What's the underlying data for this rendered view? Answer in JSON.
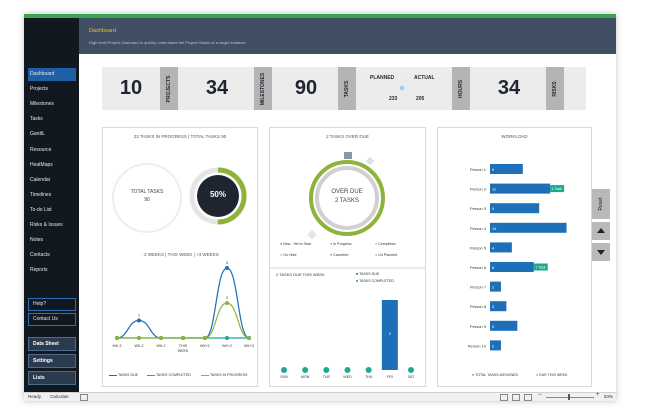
{
  "sidebar": {
    "items": [
      "Dashboard",
      "Projects",
      "Milestones",
      "Tasks",
      "GanttL",
      "Resource",
      "HeatMaps",
      "Calendar",
      "Timelines",
      "To-do List",
      "Risks & Issues",
      "Notes",
      "Contacts",
      "Reports"
    ],
    "links": [
      "Help?",
      "Contact Us"
    ],
    "buttons": [
      "Data Sheet",
      "Settings",
      "Lists"
    ]
  },
  "header": {
    "title": "Dashboard",
    "subtitle": "High level Project Dasboard to quickly understand the Project Status at a single instance"
  },
  "kpis": {
    "projects": {
      "value": "10",
      "label": "PROJECTS"
    },
    "milestones": {
      "value": "34",
      "label": "MILESTONES"
    },
    "tasks": {
      "value": "90",
      "label": "TASKS"
    },
    "hours": {
      "planned_label": "PLANNED",
      "actual_label": "ACTUAL",
      "planned": "233",
      "actual": "205",
      "label": "HOURS"
    },
    "risks": {
      "value": "34",
      "label": "RISKS"
    }
  },
  "panel1": {
    "title": "23 TASKS IN PROGRESS | TOTAL TASKS 90",
    "total_label": "TOTAL TASKS",
    "total_value": "90",
    "percent": "50%",
    "percent_value": 0.5,
    "weeks_title": "- 3 WEEKS | THIS WEEK | +3 WEEKS",
    "legend": [
      "TASKS DUE",
      "TASKS COMPLETED",
      "TASKS IN PROGRESS"
    ]
  },
  "panel2": {
    "title": "2 TASKS OVER DUE",
    "center1": "OVER DUE",
    "center2": "2 TASKS",
    "legend": [
      "New - Yet to Start",
      "In Progress",
      "Completed",
      "On Hold",
      "Canceled",
      "Un Planned"
    ],
    "week_title": "2 TASKS DUE THIS WEEK",
    "week_legend": [
      "TASKS DUE",
      "TASKS COMPLETED"
    ]
  },
  "panel3": {
    "title": "WORKLOAD",
    "legend": [
      "TOTAL TASKS ASSIGNED",
      "DUE THIS WEEK"
    ]
  },
  "right_buttons": {
    "reset": "Reset"
  },
  "statusbar": {
    "ready": "Ready",
    "calc": "Calculate",
    "zoom": "83%"
  },
  "colors": {
    "blue": "#1d6fb8",
    "teal": "#1fa88e",
    "olive": "#8db33a",
    "dark": "#1e2430"
  },
  "chart_data": [
    {
      "type": "line",
      "categories": [
        "WK-3",
        "WK-2",
        "WK-1",
        "THIS WEEK",
        "WK+1",
        "WK+2",
        "WK+3"
      ],
      "series": [
        {
          "name": "TASKS DUE",
          "values": [
            0,
            1,
            0,
            0,
            0,
            4,
            0
          ],
          "color": "#1d6fb8"
        },
        {
          "name": "TASKS COMPLETED",
          "values": [
            0,
            0,
            0,
            0,
            0,
            0,
            0
          ],
          "color": "#1fa88e"
        },
        {
          "name": "TASKS IN PROGRESS",
          "values": [
            0,
            0,
            0,
            0,
            0,
            2,
            0
          ],
          "color": "#8db33a"
        }
      ],
      "data_labels": [
        {
          "series": 0,
          "index": 1,
          "text": "1"
        },
        {
          "series": 0,
          "index": 5,
          "text": "4"
        },
        {
          "series": 2,
          "index": 5,
          "text": "2"
        }
      ]
    },
    {
      "type": "bar",
      "title": "2 TASKS DUE THIS WEEK",
      "categories": [
        "SUN",
        "MON",
        "TUE",
        "WED",
        "THU",
        "FRI",
        "SAT"
      ],
      "series": [
        {
          "name": "TASKS DUE",
          "values": [
            0,
            0,
            0,
            0,
            0,
            2,
            0
          ]
        },
        {
          "name": "TASKS COMPLETED",
          "values": [
            0,
            0,
            0,
            0,
            0,
            0,
            0
          ]
        }
      ]
    },
    {
      "type": "bar",
      "title": "WORKLOAD",
      "categories": [
        "Person 1",
        "Person 2",
        "Person 3",
        "Person 4",
        "Person 5",
        "Person 6",
        "Person 7",
        "Person 8",
        "Person 9",
        "Person 10"
      ],
      "series": [
        {
          "name": "TOTAL TASKS ASSIGNED",
          "values": [
            6,
            11,
            9,
            14,
            4,
            8,
            2,
            3,
            5,
            2
          ]
        },
        {
          "name": "DUE THIS WEEK",
          "values": [
            0,
            1,
            0,
            0,
            0,
            1,
            0,
            0,
            0,
            0
          ]
        }
      ],
      "due_labels": [
        "",
        "1 Task",
        "",
        "",
        "",
        "1 Task",
        "",
        "",
        "",
        ""
      ],
      "xlim": [
        0,
        15
      ]
    }
  ]
}
